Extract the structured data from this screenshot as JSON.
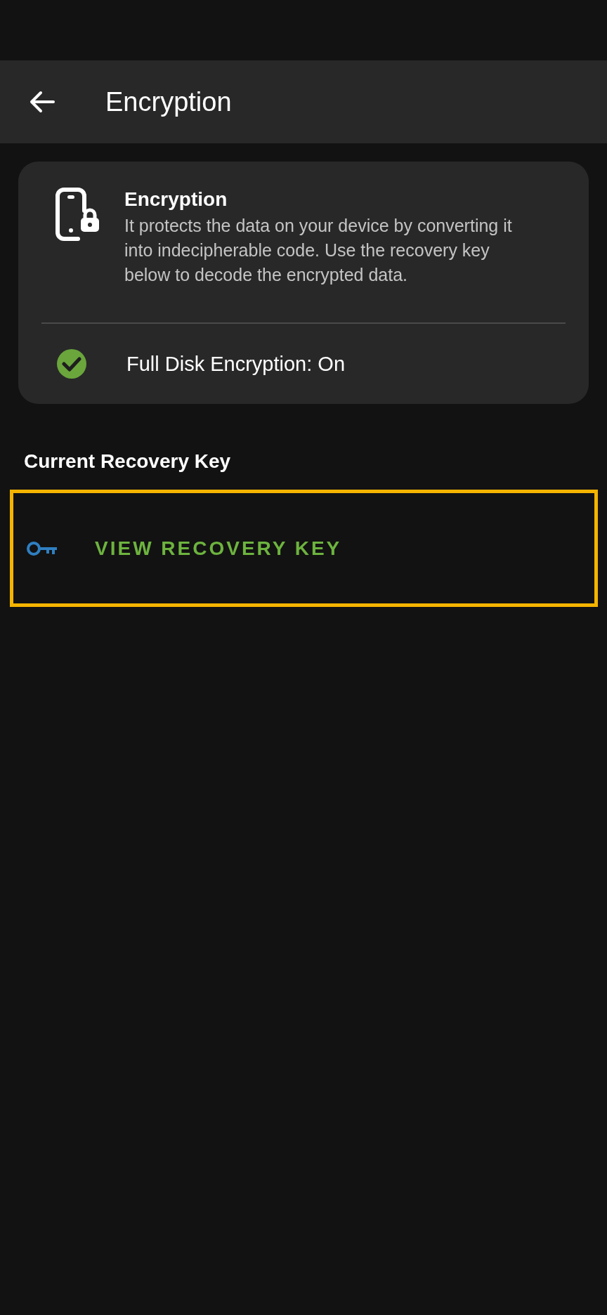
{
  "app_bar": {
    "title": "Encryption"
  },
  "info_card": {
    "title": "Encryption",
    "description": "It protects the data on your device by converting it into indecipherable code. Use the recovery key below to decode the encrypted data.",
    "status": {
      "text": "Full Disk Encryption: On",
      "on": true
    }
  },
  "recovery_section": {
    "title": "Current Recovery Key",
    "button": {
      "label": "VIEW RECOVERY KEY",
      "focused": true
    }
  }
}
